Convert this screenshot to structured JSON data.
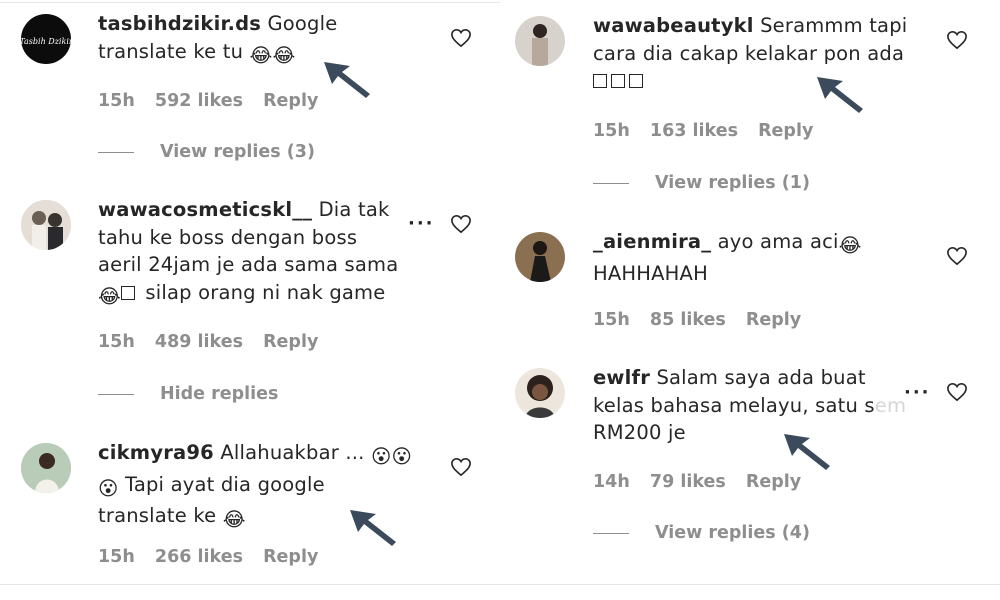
{
  "left": {
    "comments": [
      {
        "username": "tasbihdzikir.ds",
        "text": "Google translate ke tu",
        "emoji": "😂😂",
        "time": "15h",
        "likes": "592 likes",
        "reply": "Reply",
        "replies_label": "View replies (3)"
      },
      {
        "username": "wawacosmeticskl__",
        "text_line1": "Dia tak",
        "text_line2": "tahu ke boss dengan boss",
        "text_line3": "aeril 24jam je ada sama sama",
        "text_line4_emoji": "😂",
        "text_line4": "silap orang ni nak game",
        "more": "···",
        "time": "15h",
        "likes": "489 likes",
        "reply": "Reply",
        "replies_label": "Hide replies"
      },
      {
        "username": "cikmyra96",
        "text_line1": "Allahuakbar ...",
        "emoji_a": "😮😮",
        "emoji_b": "😮",
        "text_line2": "Tapi ayat dia google",
        "text_line3": "translate ke",
        "emoji_c": "😂",
        "time": "15h",
        "likes": "266 likes",
        "reply": "Reply"
      }
    ]
  },
  "right": {
    "comments": [
      {
        "username": "wawabeautykl",
        "text_line1": "Serammm tapi",
        "text_line2": "cara dia cakap kelakar pon ada",
        "time": "15h",
        "likes": "163 likes",
        "reply": "Reply",
        "replies_label": "View replies (1)"
      },
      {
        "username": "_aienmira_",
        "text_line1": "ayo ama aci",
        "emoji": "😂",
        "text_line2": "HAHHAHAH",
        "time": "15h",
        "likes": "85 likes",
        "reply": "Reply"
      },
      {
        "username": "ewlfr",
        "text_line1": "Salam saya ada buat",
        "text_line2": "kelas bahasa melayu, satu s",
        "text_line2_fade": "em",
        "text_line3": "RM200 je",
        "more": "···",
        "time": "14h",
        "likes": "79 likes",
        "reply": "Reply",
        "replies_label": "View replies (4)"
      }
    ]
  },
  "colors": {
    "text": "#262626",
    "muted": "#8e8e8e",
    "arrow": "#3b4b5c"
  }
}
